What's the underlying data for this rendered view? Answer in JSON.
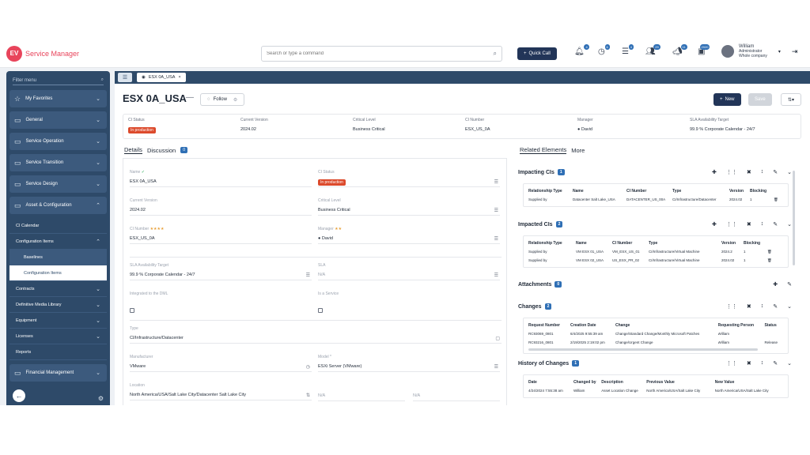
{
  "app": {
    "logo_badge": "EV",
    "title": "Service Manager"
  },
  "search": {
    "placeholder": "Search or type a command"
  },
  "quick_call": "Quick Call",
  "notifications": {
    "bell": "4",
    "clock": "6",
    "list": "4",
    "users": "29",
    "megaphone": "11",
    "tickets": "2020"
  },
  "user": {
    "name": "William",
    "role": "Administrator",
    "company": "Whole company"
  },
  "sidebar": {
    "filter_placeholder": "Filter menu",
    "items": [
      {
        "label": "My Favorites",
        "icon": "star-icon"
      },
      {
        "label": "General",
        "icon": "folder-icon"
      },
      {
        "label": "Service Operation",
        "icon": "folder-icon"
      },
      {
        "label": "Service Transition",
        "icon": "folder-icon"
      },
      {
        "label": "Service Design",
        "icon": "folder-icon"
      },
      {
        "label": "Asset & Configuration",
        "icon": "folder-icon"
      }
    ],
    "sub": {
      "ci_calendar": "CI Calendar",
      "configuration_items": "Configuration Items",
      "baselines": "Baselines",
      "configuration_items_active": "Configuration Items",
      "contracts": "Contracts",
      "dml": "Definitive Media Library",
      "equipment": "Equipment",
      "licenses": "Licenses",
      "reports": "Reports",
      "financial": "Financial Management"
    }
  },
  "tab": {
    "label": "ESX 0A_USA"
  },
  "record": {
    "title": "ESX 0A_USA",
    "follow": "Follow",
    "new": "New",
    "save": "Save"
  },
  "summary": {
    "ci_status_label": "CI Status",
    "ci_status": "In production",
    "current_version_label": "Current Version",
    "current_version": "2024.02",
    "critical_level_label": "Critical Level",
    "critical_level": "Business Critical",
    "ci_number_label": "CI Number",
    "ci_number": "ESX_US_0A",
    "manager_label": "Manager",
    "manager": "David",
    "sla_label": "SLA Availability Target",
    "sla": "99.9 % Corporate Calendar - 24/7"
  },
  "left_tabs": {
    "details": "Details",
    "discussion": "Discussion",
    "discussion_count": "0"
  },
  "form": {
    "name_label": "Name",
    "name": "ESX 0A_USA",
    "ci_status_label": "CI Status",
    "ci_status": "In production",
    "current_version_label": "Current Version",
    "current_version": "2024.02",
    "critical_level_label": "Critical Level",
    "critical_level": "Business Critical",
    "ci_number_label": "CI Number",
    "ci_number": "ESX_US_0A",
    "manager_label": "Manager",
    "manager": "David",
    "sla_label": "SLA Availability Target",
    "sla": "99.9 % Corporate Calendar - 24/7",
    "sla2_label": "SLA",
    "sla2": "N/A",
    "dml_label": "Integrated to the DML",
    "is_service_label": "Is a Service",
    "type_label": "Type",
    "type": "CI/Infrastructure/Datacenter",
    "manufacturer_label": "Manufacturer",
    "manufacturer": "VMware",
    "model_label": "Model *",
    "model": "ESXi Server (VMware)",
    "location_label": "Location",
    "location": "North America/USA/Salt Lake City/Datacenter Salt Lake City",
    "na1": "N/A",
    "na2": "N/A"
  },
  "right_tabs": {
    "related": "Related Elements",
    "more": "More"
  },
  "impacting": {
    "title": "Impacting CIs",
    "count": "1",
    "headers": [
      "Relationship Type",
      "Name",
      "CI Number",
      "Type",
      "Version",
      "Blocking"
    ],
    "rows": [
      [
        "Supplied by",
        "Datacenter Salt Lake_USA",
        "DATACENTER_US_00A",
        "CI/Infrastructure/Datacenter",
        "2024.02",
        "1"
      ]
    ]
  },
  "impacted": {
    "title": "Impacted CIs",
    "count": "2",
    "headers": [
      "Relationship Type",
      "Name",
      "CI Number",
      "Type",
      "Version",
      "Blocking"
    ],
    "rows": [
      [
        "Supplied by",
        "VM ESX 01_USA",
        "VM_ESX_US_01",
        "CI/Infrastructure/Virtual Machine",
        "2024.2",
        "1"
      ],
      [
        "Supplied by",
        "VM ESX 02_USA",
        "US_ESX_PR_02",
        "CI/Infrastructure/Virtual Machine",
        "2024.02",
        "1"
      ]
    ]
  },
  "attachments": {
    "title": "Attachments",
    "count": "0"
  },
  "changes": {
    "title": "Changes",
    "count": "2",
    "headers": [
      "Request Number",
      "Creation Date",
      "Change",
      "Requesting Person",
      "Status"
    ],
    "rows": [
      [
        "RC93069_0801",
        "6/4/2025 9:55:39 am",
        "Change/Standard Change/Monthly Microsoft Patches",
        "William",
        ""
      ],
      [
        "RC93216_0801",
        "2/19/2025 2:19:02 pm",
        "Change/Urgent Change",
        "William",
        "Release"
      ]
    ]
  },
  "history": {
    "title": "History of Changes",
    "count": "1",
    "headers": [
      "Date",
      "Changed by",
      "Description",
      "Previous Value",
      "New Value"
    ],
    "rows": [
      [
        "4/24/2024 7:55:38 am",
        "William",
        "Asset Location Change",
        "North America/USA/Salt Lake City",
        "North America/USA/Salt Lake City"
      ]
    ]
  }
}
